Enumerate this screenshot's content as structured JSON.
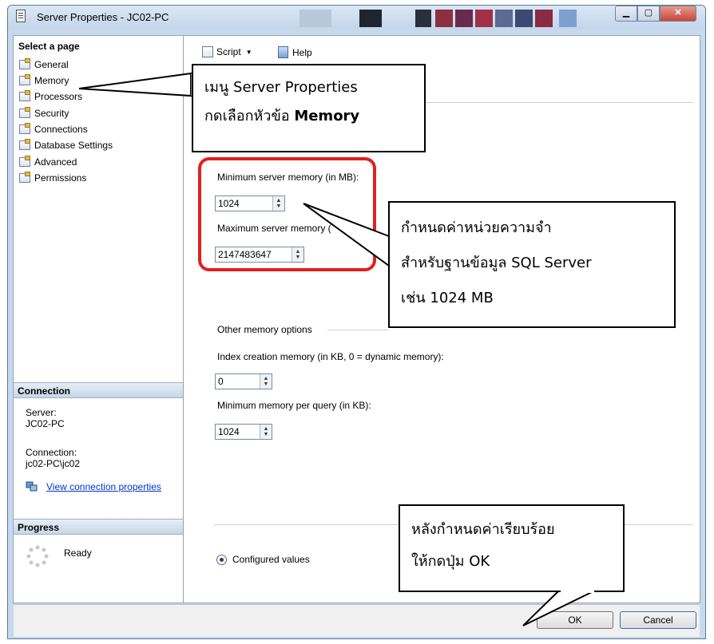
{
  "window": {
    "title": "Server Properties - JC02-PC"
  },
  "sidebar": {
    "header": "Select a page",
    "items": [
      "General",
      "Memory",
      "Processors",
      "Security",
      "Connections",
      "Database Settings",
      "Advanced",
      "Permissions"
    ]
  },
  "toolbar": {
    "script_label": "Script",
    "help_label": "Help"
  },
  "memory": {
    "min_label": "Minimum server memory (in MB):",
    "min_value": "1024",
    "max_label": "Maximum server memory (",
    "max_value": "2147483647",
    "other_options_label": "Other memory options",
    "index_label": "Index creation memory (in KB, 0 = dynamic memory):",
    "index_value": "0",
    "min_query_label": "Minimum memory per query (in KB):",
    "min_query_value": "1024",
    "configured_values_label": "Configured values"
  },
  "connection": {
    "header": "Connection",
    "server_label": "Server:",
    "server_value": "JC02-PC",
    "connection_label": "Connection:",
    "connection_value": "jc02-PC\\jc02",
    "view_link": "View connection properties"
  },
  "progress": {
    "header": "Progress",
    "status": "Ready"
  },
  "buttons": {
    "ok": "OK",
    "cancel": "Cancel"
  },
  "callouts": {
    "menu_line1": "เมนู Server Properties",
    "menu_line2": "กดเลือกหัวข้อ",
    "menu_bold": "Memory",
    "memory_line1": "กำหนดค่าหน่วยความจำ",
    "memory_line2": "สำหรับฐานข้อมูล SQL Server",
    "memory_line3": "เช่น 1024 MB",
    "ok_line1": "หลังกำหนดค่าเรียบร้อย",
    "ok_line2": "ให้กดปุ่ม OK"
  },
  "colors": {
    "highlight": "#e0201c",
    "link": "#0033cc"
  }
}
